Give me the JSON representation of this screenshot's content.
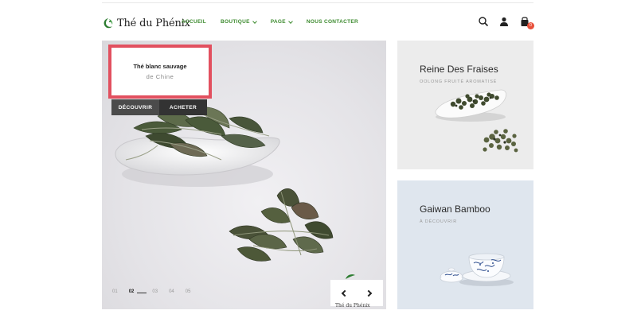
{
  "brand": {
    "name": "Thé du Phénix",
    "accent": "#3d8b2f"
  },
  "nav": {
    "items": [
      {
        "label": "ACCUEIL",
        "dropdown": false
      },
      {
        "label": "BOUTIQUE",
        "dropdown": true
      },
      {
        "label": "PAGE",
        "dropdown": true
      },
      {
        "label": "NOUS CONTACTER",
        "dropdown": false
      }
    ]
  },
  "header_icons": {
    "search": "search-icon",
    "account": "user-icon",
    "cart": "cart-icon",
    "cart_count": "0"
  },
  "hero": {
    "caption_title": "Thé blanc sauvage",
    "caption_subtitle": "de Chine",
    "buttons": {
      "discover": "DÉCOUVRIR",
      "buy": "ACHETER"
    },
    "pager": {
      "pages": [
        "01",
        "02",
        "03",
        "04",
        "05"
      ],
      "active": "02"
    },
    "watermark": "Thé du Phénix",
    "caption_border_color": "#e2505f"
  },
  "banners": [
    {
      "title": "Reine Des Fraises",
      "subtitle": "OOLONG FRUITÉ AROMATISÉ"
    },
    {
      "title": "Gaiwan Bamboo",
      "subtitle": "À DÉCOUVRIR"
    }
  ]
}
